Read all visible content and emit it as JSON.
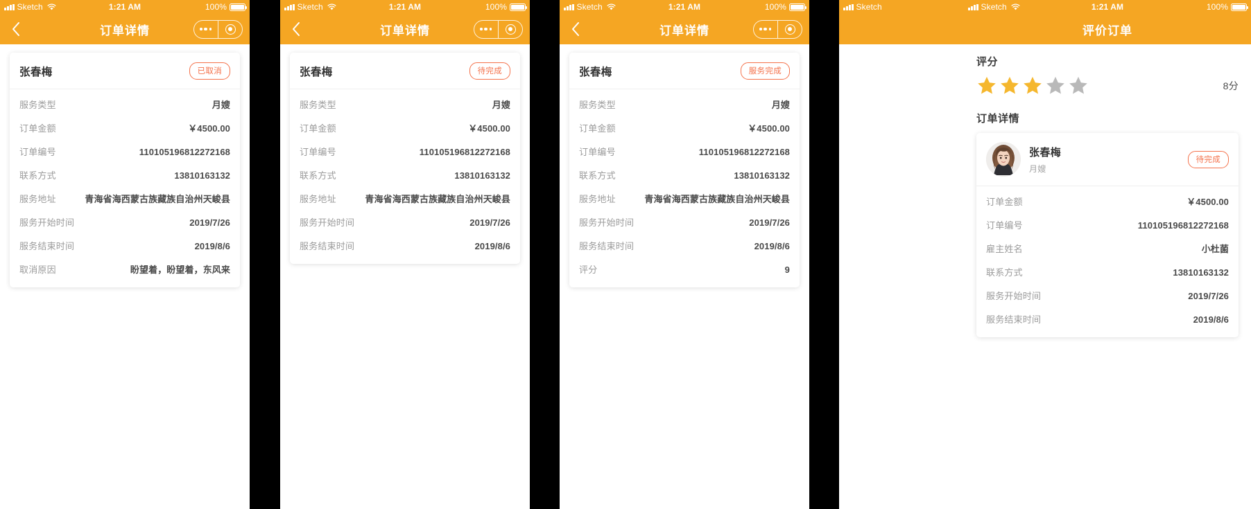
{
  "theme": {
    "brand_orange": "#F5A623",
    "badge_orange": "#F4714A",
    "star_filled": "#F5B72E",
    "star_empty": "#B9B9B9",
    "label_gray": "#9B9B9B",
    "value_gray": "#4A4A4A"
  },
  "status_bar": {
    "carrier": "Sketch",
    "time": "1:21 AM",
    "battery": "100%",
    "icons": {
      "signal": "signal-bars-icon",
      "wifi": "wifi-icon",
      "battery": "battery-full-icon"
    }
  },
  "panels": [
    {
      "id": "order-detail-cancelled",
      "nav": {
        "title": "订单详情",
        "back_icon": "chevron-left-icon",
        "more_icon": "more-dots-icon",
        "target_icon": "target-circle-icon"
      },
      "card": {
        "customer_name": "张春梅",
        "status_badge": "已取消",
        "rows": [
          {
            "label": "服务类型",
            "value": "月嫂"
          },
          {
            "label": "订单金额",
            "value": "￥4500.00"
          },
          {
            "label": "订单编号",
            "value": "110105196812272168"
          },
          {
            "label": "联系方式",
            "value": "13810163132"
          },
          {
            "label": "服务地址",
            "value": "青海省海西蒙古族藏族自治州天峻县"
          },
          {
            "label": "服务开始时间",
            "value": "2019/7/26"
          },
          {
            "label": "服务结束时间",
            "value": "2019/8/6"
          },
          {
            "label": "取消原因",
            "value": "盼望着，盼望着，东风来"
          }
        ]
      }
    },
    {
      "id": "order-detail-pending",
      "nav": {
        "title": "订单详情",
        "back_icon": "chevron-left-icon",
        "more_icon": "more-dots-icon",
        "target_icon": "target-circle-icon"
      },
      "card": {
        "customer_name": "张春梅",
        "status_badge": "待完成",
        "rows": [
          {
            "label": "服务类型",
            "value": "月嫂"
          },
          {
            "label": "订单金额",
            "value": "￥4500.00"
          },
          {
            "label": "订单编号",
            "value": "110105196812272168"
          },
          {
            "label": "联系方式",
            "value": "13810163132"
          },
          {
            "label": "服务地址",
            "value": "青海省海西蒙古族藏族自治州天峻县"
          },
          {
            "label": "服务开始时间",
            "value": "2019/7/26"
          },
          {
            "label": "服务结束时间",
            "value": "2019/8/6"
          }
        ]
      }
    },
    {
      "id": "order-detail-completed",
      "nav": {
        "title": "订单详情",
        "back_icon": "chevron-left-icon",
        "more_icon": "more-dots-icon",
        "target_icon": "target-circle-icon"
      },
      "card": {
        "customer_name": "张春梅",
        "status_badge": "服务完成",
        "rows": [
          {
            "label": "服务类型",
            "value": "月嫂"
          },
          {
            "label": "订单金额",
            "value": "￥4500.00"
          },
          {
            "label": "订单编号",
            "value": "110105196812272168"
          },
          {
            "label": "联系方式",
            "value": "13810163132"
          },
          {
            "label": "服务地址",
            "value": "青海省海西蒙古族藏族自治州天峻县"
          },
          {
            "label": "服务开始时间",
            "value": "2019/7/26"
          },
          {
            "label": "服务结束时间",
            "value": "2019/8/6"
          },
          {
            "label": "评分",
            "value": "9"
          }
        ]
      }
    },
    {
      "id": "order-review",
      "nav": {
        "title": "评价订单",
        "back_icon": "chevron-left-icon"
      },
      "rating_section": {
        "title": "评分",
        "stars_total": 5,
        "stars_filled": 3,
        "score_text": "8分"
      },
      "detail_section": {
        "title": "订单详情",
        "worker": {
          "name": "张春梅",
          "role": "月嫂",
          "status_badge": "待完成",
          "avatar_icon": "user-avatar-photo"
        },
        "rows": [
          {
            "label": "订单金额",
            "value": "￥4500.00"
          },
          {
            "label": "订单编号",
            "value": "110105196812272168"
          },
          {
            "label": "雇主姓名",
            "value": "小杜菌"
          },
          {
            "label": "联系方式",
            "value": "13810163132"
          },
          {
            "label": "服务开始时间",
            "value": "2019/7/26"
          },
          {
            "label": "服务结束时间",
            "value": "2019/8/6"
          }
        ]
      }
    }
  ]
}
